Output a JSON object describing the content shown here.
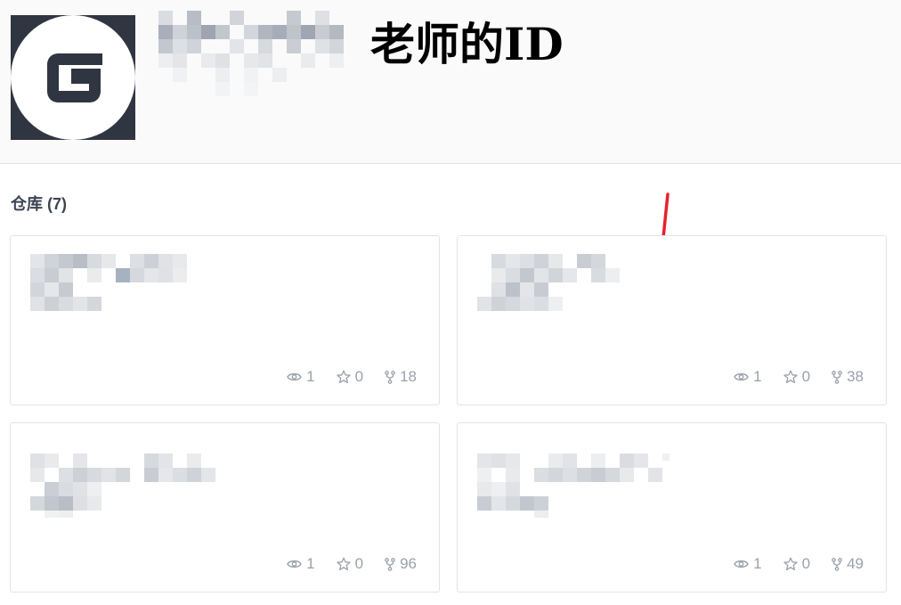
{
  "profile": {
    "avatar_icon": "gitee-logo-icon",
    "teacher_id_label": "老师的ID"
  },
  "section": {
    "title": "仓库 (7)"
  },
  "repos": [
    {
      "watch": "1",
      "star": "0",
      "fork": "18"
    },
    {
      "watch": "1",
      "star": "0",
      "fork": "38"
    },
    {
      "watch": "1",
      "star": "0",
      "fork": "96"
    },
    {
      "watch": "1",
      "star": "0",
      "fork": "49"
    }
  ],
  "icons": {
    "watch": "eye-icon",
    "star": "star-icon",
    "fork": "fork-icon"
  },
  "colors": {
    "annotation_arrow": "#e8202a",
    "avatar_bg": "#2f3541",
    "stat_text": "#9aa1ab"
  }
}
